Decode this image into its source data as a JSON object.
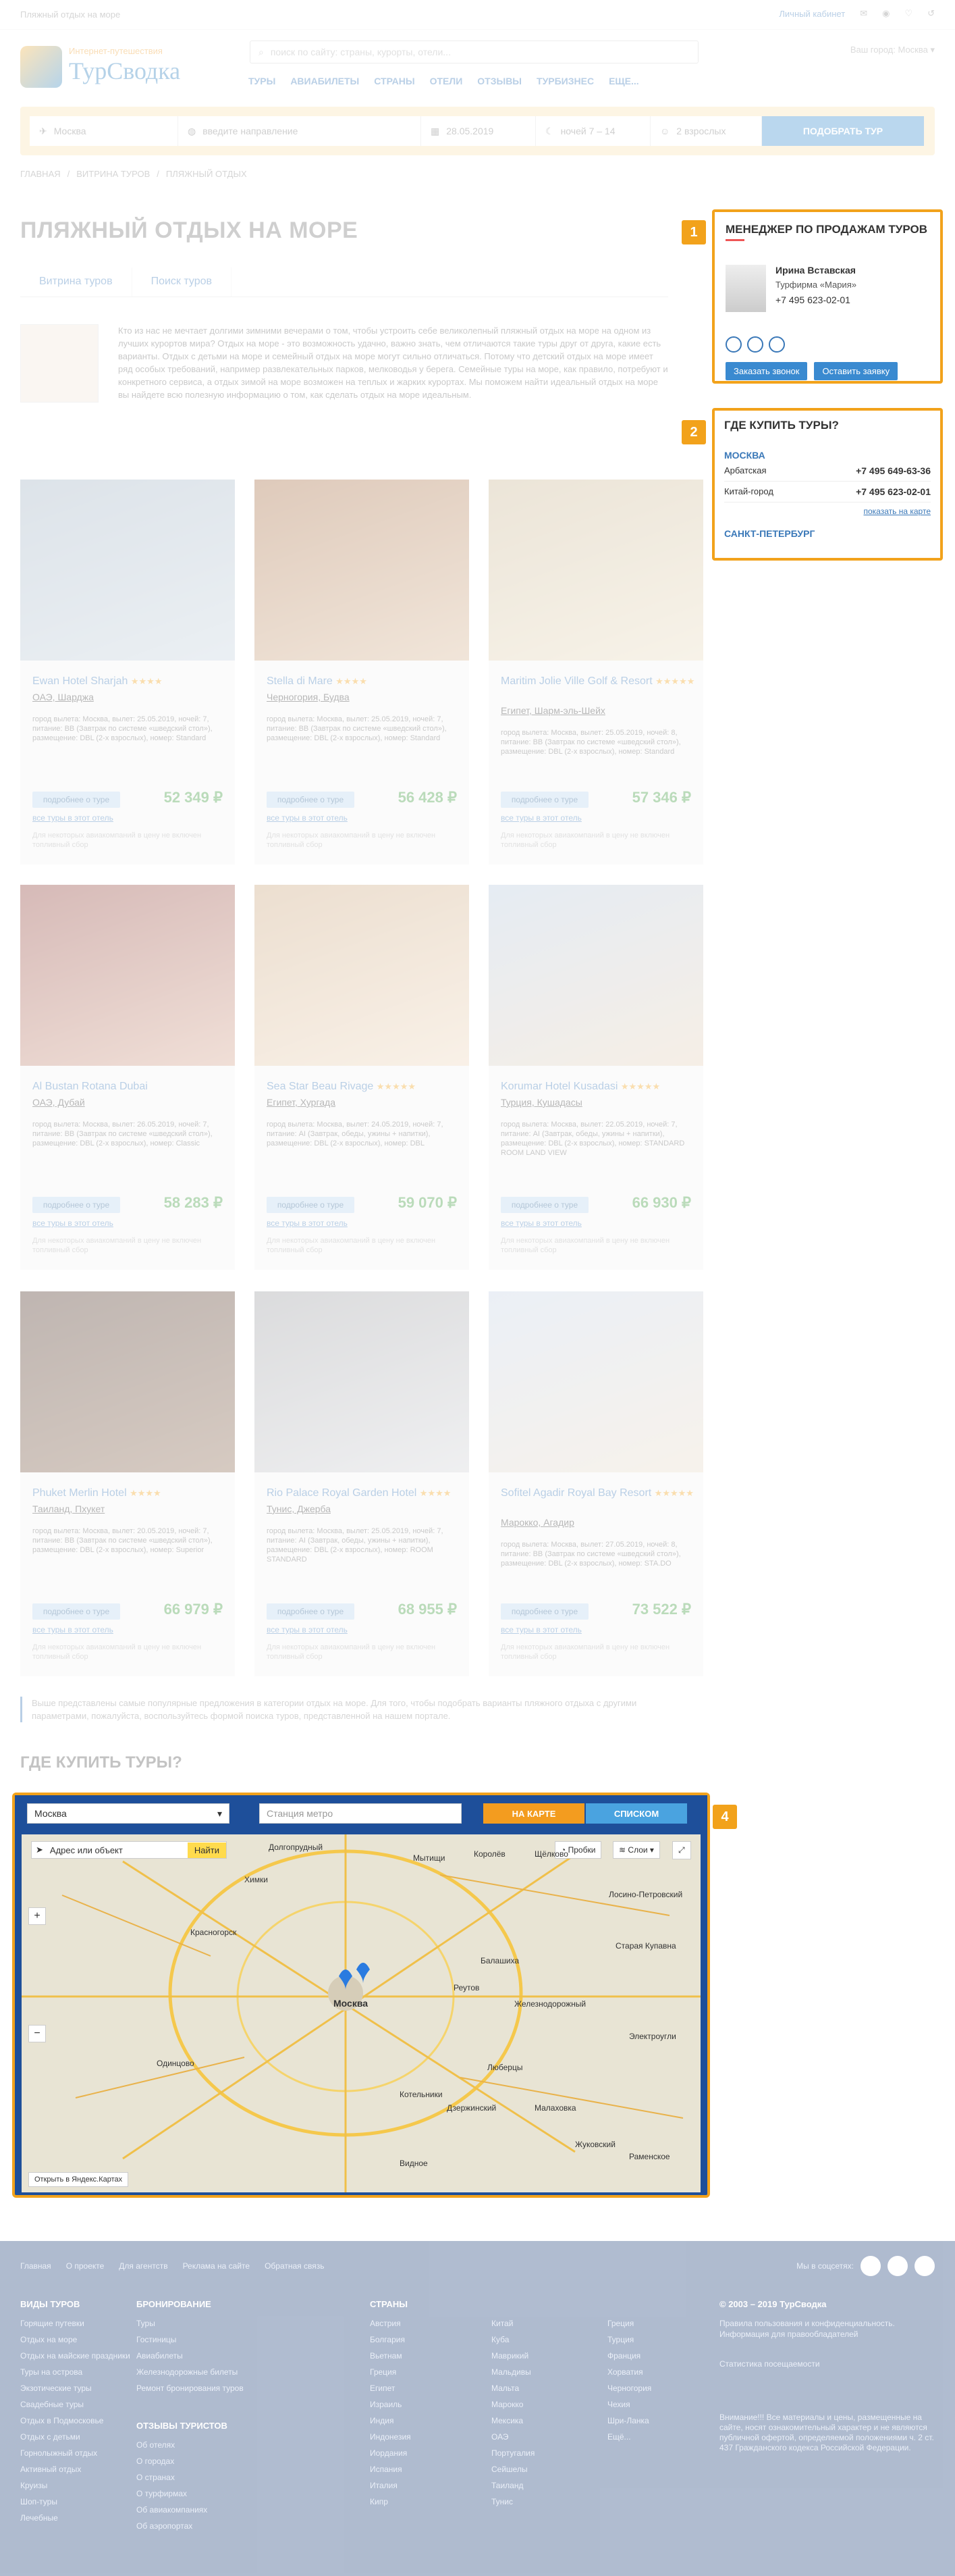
{
  "topbar": {
    "breadcrumb": "Пляжный отдых на море",
    "cabinet": "Личный кабинет"
  },
  "header": {
    "logo_small": "Интернет-путешествия",
    "logo_big": "ТурСводка",
    "search_placeholder": "поиск по сайту: страны, курорты, отели...",
    "city_label": "Ваш город:",
    "city_value": "Москва"
  },
  "nav": [
    "ТУРЫ",
    "АВИАБИЛЕТЫ",
    "СТРАНЫ",
    "ОТЕЛИ",
    "ОТЗЫВЫ",
    "ТУРБИЗНЕС",
    "ЕЩЕ..."
  ],
  "search_strip": {
    "from": "Москва",
    "to_placeholder": "введите направление",
    "date": "28.05.2019",
    "nights": "ночей 7 – 14",
    "people": "2 взрослых",
    "button": "ПОДОБРАТЬ ТУР"
  },
  "breadcrumbs": [
    "ГЛАВНАЯ",
    "ВИТРИНА ТУРОВ",
    "ПЛЯЖНЫЙ ОТДЫХ"
  ],
  "page_title": "ПЛЯЖНЫЙ ОТДЫХ НА МОРЕ",
  "tabs": [
    "Витрина туров",
    "Поиск туров"
  ],
  "intro": "Кто из нас не мечтает долгими зимними вечерами о том, чтобы устроить себе великолепный пляжный отдых на море на одном из лучших курортов мира? Отдых на море - это возможность удачно, важно знать, чем отличаются такие туры друг от друга, какие есть варианты. Отдых с детьми на море и семейный отдых на море могут сильно отличаться. Потому что детский отдых на море имеет ряд особых требований, например развлекательных парков, мелководья у берега. Семейные туры на море, как правило, потребуют и конкретного сервиса, а отдых зимой на море возможен на теплых и жарких курортах. Мы поможем найти идеальный отдых на море вы найдете всю полезную информацию о том, как сделать отдых на море идеальным.",
  "hotels": [
    {
      "name": "Ewan Hotel Sharjah",
      "stars": "★★★★",
      "loc": "ОАЭ, Шарджа",
      "det": "город вылета: Москва, вылет: 25.05.2019, ночей: 7, питание: BB (Завтрак по системе «шведский стол»), размещение: DBL (2-х взрослых), номер: Standard",
      "price": "52 349 ₽",
      "more": "подробнее о туре",
      "all": "все туры в этот отель",
      "note": "Для некоторых авиакомпаний в цену не включен топливный сбор"
    },
    {
      "name": "Stella di Mare",
      "stars": "★★★★",
      "loc": "Черногория, Будва",
      "det": "город вылета: Москва, вылет: 25.05.2019, ночей: 7, питание: BB (Завтрак по системе «шведский стол»), размещение: DBL (2-х взрослых), номер: Standard",
      "price": "56 428 ₽",
      "more": "подробнее о туре",
      "all": "все туры в этот отель",
      "note": "Для некоторых авиакомпаний в цену не включен топливный сбор"
    },
    {
      "name": "Maritim Jolie Ville Golf & Resort",
      "stars": "★★★★★",
      "loc": "Египет, Шарм-эль-Шейх",
      "det": "город вылета: Москва, вылет: 25.05.2019, ночей: 8, питание: BB (Завтрак по системе «шведский стол»), размещение: DBL (2-х взрослых), номер: Standard",
      "price": "57 346 ₽",
      "more": "подробнее о туре",
      "all": "все туры в этот отель",
      "note": "Для некоторых авиакомпаний в цену не включен топливный сбор"
    },
    {
      "name": "Al Bustan Rotana Dubai",
      "stars": "",
      "loc": "ОАЭ, Дубай",
      "det": "город вылета: Москва, вылет: 26.05.2019, ночей: 7, питание: BB (Завтрак по системе «шведский стол»), размещение: DBL (2-х взрослых), номер: Classic",
      "price": "58 283 ₽",
      "more": "подробнее о туре",
      "all": "все туры в этот отель",
      "note": "Для некоторых авиакомпаний в цену не включен топливный сбор"
    },
    {
      "name": "Sea Star Beau Rivage",
      "stars": "★★★★★",
      "loc": "Египет, Хургада",
      "det": "город вылета: Москва, вылет: 24.05.2019, ночей: 7, питание: AI (Завтрак, обеды, ужины + напитки), размещение: DBL (2-х взрослых), номер: DBL",
      "price": "59 070 ₽",
      "more": "подробнее о туре",
      "all": "все туры в этот отель",
      "note": "Для некоторых авиакомпаний в цену не включен топливный сбор"
    },
    {
      "name": "Korumar Hotel Kusadasi",
      "stars": "★★★★★",
      "loc": "Турция, Кушадасы",
      "det": "город вылета: Москва, вылет: 22.05.2019, ночей: 7, питание: AI (Завтрак, обеды, ужины + напитки), размещение: DBL (2-х взрослых), номер: STANDARD ROOM LAND VIEW",
      "price": "66 930 ₽",
      "more": "подробнее о туре",
      "all": "все туры в этот отель",
      "note": "Для некоторых авиакомпаний в цену не включен топливный сбор"
    },
    {
      "name": "Phuket Merlin Hotel",
      "stars": "★★★★",
      "loc": "Таиланд, Пхукет",
      "det": "город вылета: Москва, вылет: 20.05.2019, ночей: 7, питание: BB (Завтрак по системе «шведский стол»), размещение: DBL (2-х взрослых), номер: Superior",
      "price": "66 979 ₽",
      "more": "подробнее о туре",
      "all": "все туры в этот отель",
      "note": "Для некоторых авиакомпаний в цену не включен топливный сбор"
    },
    {
      "name": "Rio Palace Royal Garden Hotel",
      "stars": "★★★★",
      "loc": "Тунис, Джерба",
      "det": "город вылета: Москва, вылет: 25.05.2019, ночей: 7, питание: AI (Завтрак, обеды, ужины + напитки), размещение: DBL (2-х взрослых), номер: ROOM STANDARD",
      "price": "68 955 ₽",
      "more": "подробнее о туре",
      "all": "все туры в этот отель",
      "note": "Для некоторых авиакомпаний в цену не включен топливный сбор"
    },
    {
      "name": "Sofitel Agadir Royal Bay Resort",
      "stars": "★★★★★",
      "loc": "Марокко, Агадир",
      "det": "город вылета: Москва, вылет: 27.05.2019, ночей: 8, питание: BB (Завтрак по системе «шведский стол»), размещение: DBL (2-х взрослых), номер: STA.DO",
      "price": "73 522 ₽",
      "more": "подробнее о туре",
      "all": "все туры в этот отель",
      "note": "Для некоторых авиакомпаний в цену не включен топливный сбор"
    }
  ],
  "bottom_note": "Выше представлены самые популярные предложения в категории отдых на море. Для того, чтобы подобрать варианты пляжного отдыха с другими параметрами, пожалуйста, воспользуйтесь формой поиска туров, представленной на нашем портале.",
  "where_title": "ГДЕ КУПИТЬ ТУРЫ?",
  "manager": {
    "title": "МЕНЕДЖЕР ПО ПРОДАЖАМ ТУРОВ",
    "name": "Ирина Вставская",
    "company": "Турфирма «Мария»",
    "phone": "+7 495 623-02-01",
    "btn_call": "Заказать звонок",
    "btn_request": "Оставить заявку"
  },
  "buy": {
    "title": "ГДЕ КУПИТЬ ТУРЫ?",
    "city1": "МОСКВА",
    "offices": [
      {
        "name": "Арбатская",
        "phone": "+7 495 649-63-36"
      },
      {
        "name": "Китай-город",
        "phone": "+7 495 623-02-01"
      }
    ],
    "show_map": "показать на карте",
    "city2": "САНКТ-ПЕТЕРБУРГ"
  },
  "badges": [
    "1",
    "2",
    "4"
  ],
  "map": {
    "city": "Москва",
    "metro_placeholder": "Станция метро",
    "btn_map": "НА КАРТЕ",
    "btn_list": "СПИСКОМ",
    "address_placeholder": "Адрес или объект",
    "find": "Найти",
    "traffic": "Пробки",
    "layers": "Слои",
    "open_yandex": "Открыть в Яндекс.Картах",
    "labels": [
      "Долгопрудный",
      "Химки",
      "Мытищи",
      "Королёв",
      "Щёлково",
      "Лосино-Петровский",
      "Красногорск",
      "Балашиха",
      "Москва",
      "Железнодорожный",
      "Реутов",
      "Одинцово",
      "Люберцы",
      "Дзержинский",
      "Жуковский",
      "Видное",
      "Электроугли",
      "Старая Купавна",
      "Котельники",
      "Малаховка",
      "Раменское"
    ]
  },
  "footer": {
    "links": [
      "Главная",
      "О проекте",
      "Для агентств",
      "Реклама на сайте",
      "Обратная связь"
    ],
    "social": "Мы в соцсетях:",
    "copyright": "© 2003 – 2019 ТурСводка",
    "col1_title": "ВИДЫ ТУРОВ",
    "col1": [
      "Горящие путевки",
      "Отдых на море",
      "Отдых на майские праздники",
      "Туры на острова",
      "Экзотические туры",
      "Свадебные туры",
      "Отдых в Подмосковье",
      "Отдых с детьми",
      "Горнолыжный отдых",
      "Активный отдых",
      "Круизы",
      "Шоп-туры",
      "Лечебные"
    ],
    "col2_title": "БРОНИРОВАНИЕ",
    "col2": [
      "Туры",
      "Гостиницы",
      "Авиабилеты",
      "Железнодорожные билеты",
      "Ремонт бронирования туров"
    ],
    "col3_title": "ОТЗЫВЫ ТУРИСТОВ",
    "col3": [
      "Об отелях",
      "О городах",
      "О странах",
      "О турфирмах",
      "Об авиакомпаниях",
      "Об аэропортах"
    ],
    "col4_title": "СТРАНЫ",
    "countries_a": [
      "Австрия",
      "Болгария",
      "Вьетнам",
      "Греция",
      "Египет",
      "Израиль",
      "Индия",
      "Индонезия",
      "Иордания",
      "Испания",
      "Италия",
      "Кипр"
    ],
    "countries_b": [
      "Китай",
      "Куба",
      "Маврикий",
      "Мальдивы",
      "Мальта",
      "Марокко",
      "Мексика",
      "ОАЭ",
      "Португалия",
      "Сейшелы",
      "Таиланд",
      "Тунис"
    ],
    "countries_c": [
      "Греция",
      "Турция",
      "Франция",
      "Хорватия",
      "Черногория",
      "Чехия",
      "Шри-Ланка",
      "Ещё..."
    ],
    "policy": "Правила пользования и конфиденциальность. Информация для правообладателей",
    "counter": "Статистика посещаемости",
    "disclaimer": "Внимание!!! Все материалы и цены, размещенные на сайте, носят ознакомительный характер и не являются публичной офертой, определяемой положениями ч. 2 ст. 437 Гражданского кодекса Российской Федерации."
  }
}
